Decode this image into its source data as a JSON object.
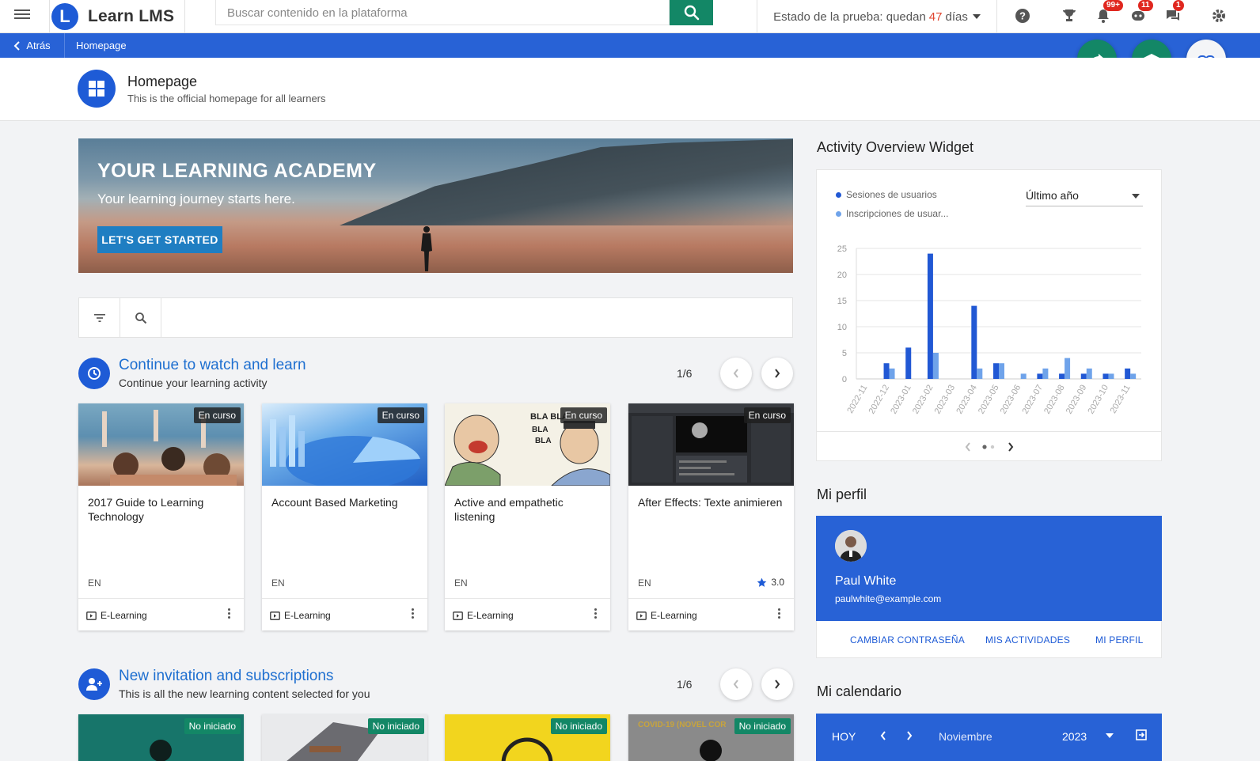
{
  "topbar": {
    "logo_letter": "L",
    "app_name": "Learn LMS",
    "search_placeholder": "Buscar contenido en la plataforma",
    "trial_prefix": "Estado de la prueba: quedan",
    "trial_days": "47",
    "trial_suffix": "días",
    "badges": {
      "notifications": "99+",
      "messages_bot": "11",
      "chat": "1"
    }
  },
  "breadcrumb": {
    "back_label": "Atrás",
    "current": "Homepage"
  },
  "page": {
    "title": "Homepage",
    "subtitle": "This is the official homepage for all learners"
  },
  "hero": {
    "title": "YOUR LEARNING ACADEMY",
    "subtitle": "Your learning journey starts here.",
    "button": "LET'S GET STARTED"
  },
  "continue_section": {
    "title": "Continue to watch and learn",
    "subtitle": "Continue your learning activity",
    "pager": "1/6",
    "cards": [
      {
        "title": "2017 Guide to Learning Technology",
        "tag": "En curso",
        "lang": "EN",
        "type": "E-Learning",
        "rating": ""
      },
      {
        "title": "Account Based Marketing",
        "tag": "En curso",
        "lang": "EN",
        "type": "E-Learning",
        "rating": ""
      },
      {
        "title": "Active and empathetic listening",
        "tag": "En curso",
        "lang": "EN",
        "type": "E-Learning",
        "rating": ""
      },
      {
        "title": "After Effects: Texte animieren",
        "tag": "En curso",
        "lang": "EN",
        "type": "E-Learning",
        "rating": "3.0"
      }
    ]
  },
  "invite_section": {
    "title": "New invitation and subscriptions",
    "subtitle": "This is all the new learning content selected for you",
    "pager": "1/6",
    "cards": [
      {
        "tag": "No iniciado",
        "color": "#17756a"
      },
      {
        "tag": "No iniciado",
        "color": "#e9eaec"
      },
      {
        "tag": "No iniciado",
        "color": "#f2d51e"
      },
      {
        "tag": "No iniciado",
        "color": "#8a8a8a"
      }
    ],
    "card4_text": "COVID-19 (NOVEL COR"
  },
  "activity_widget": {
    "title": "Activity Overview Widget",
    "period": "Último año",
    "colors": {
      "sessions": "#2158d4",
      "enrollments": "#6fa3ea"
    }
  },
  "chart_data": {
    "type": "bar",
    "categories": [
      "2022-11",
      "2022-12",
      "2023-01",
      "2023-02",
      "2023-03",
      "2023-04",
      "2023-05",
      "2023-06",
      "2023-07",
      "2023-08",
      "2023-09",
      "2023-10",
      "2023-11"
    ],
    "series": [
      {
        "name": "Sesiones de usuarios",
        "values": [
          0,
          3,
          6,
          24,
          0,
          14,
          3,
          0,
          1,
          1,
          1,
          1,
          2
        ]
      },
      {
        "name": "Inscripciones de usuar...",
        "values": [
          0,
          2,
          0,
          5,
          0,
          2,
          3,
          1,
          2,
          4,
          2,
          1,
          1
        ]
      }
    ],
    "yticks": [
      0,
      5,
      10,
      15,
      20,
      25
    ],
    "ylim": [
      0,
      25
    ],
    "legend_position": "top-left",
    "grid": true
  },
  "profile": {
    "title": "Mi perfil",
    "name": "Paul White",
    "email": "paulwhite@example.com",
    "links": [
      "CAMBIAR CONTRASEÑA",
      "MIS ACTIVIDADES",
      "MI PERFIL"
    ]
  },
  "calendar": {
    "title": "Mi calendario",
    "today": "HOY",
    "month": "Noviembre",
    "year": "2023"
  }
}
